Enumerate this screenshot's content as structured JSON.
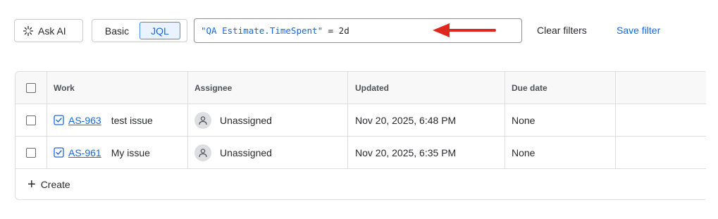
{
  "toolbar": {
    "ask_ai_label": "Ask AI",
    "mode_basic_label": "Basic",
    "mode_jql_label": "JQL",
    "active_mode": "JQL",
    "jql": {
      "field": "\"QA Estimate.TimeSpent\"",
      "operator": " = ",
      "value": "2d"
    },
    "clear_filters_label": "Clear filters",
    "save_filter_label": "Save filter"
  },
  "table": {
    "columns": [
      "Work",
      "Assignee",
      "Updated",
      "Due date"
    ],
    "rows": [
      {
        "key": "AS-963",
        "summary": "test issue",
        "assignee": "Unassigned",
        "updated": "Nov 20, 2025, 6:48 PM",
        "due": "None"
      },
      {
        "key": "AS-961",
        "summary": "My issue",
        "assignee": "Unassigned",
        "updated": "Nov 20, 2025, 6:35 PM",
        "due": "None"
      }
    ],
    "create_label": "Create"
  },
  "colors": {
    "accent": "#1868DB",
    "annotation_arrow": "#E0271F",
    "border": "#DDDEE1"
  },
  "icons": {
    "ask_ai": "sparkle-icon",
    "task": "task-checkbox-icon",
    "avatar": "person-icon",
    "create": "plus-icon",
    "annotation": "arrow-left-icon"
  }
}
